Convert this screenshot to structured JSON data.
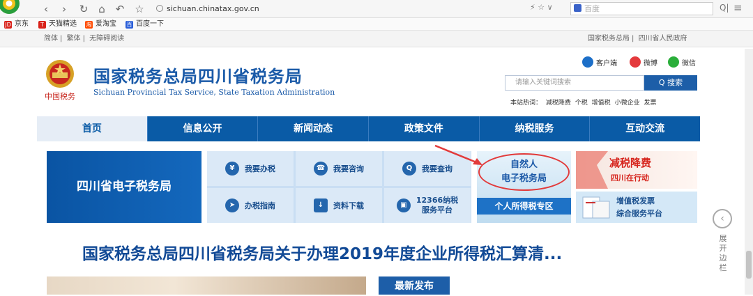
{
  "browser": {
    "url": "sichuan.chinatax.gov.cn",
    "search_placeholder": "百度",
    "right_icons": "⚡ ☆ ∨"
  },
  "bookmarks": [
    {
      "label": "京东",
      "icon_text": "JD",
      "color": "#d9231b"
    },
    {
      "label": "天猫精选",
      "icon_text": "T",
      "color": "#d9231b"
    },
    {
      "label": "爱淘宝",
      "icon_text": "淘",
      "color": "#ff4a00"
    },
    {
      "label": "百度一下",
      "icon_text": "百",
      "color": "#2b5fd9"
    }
  ],
  "util": {
    "left": [
      "简体",
      "繁体",
      "无障碍阅读"
    ],
    "right": [
      "国家税务总局",
      "四川省人民政府"
    ]
  },
  "header": {
    "logo_caption": "中国税务",
    "title": "国家税务总局四川省税务局",
    "subtitle": "Sichuan Provincial Tax Service, State Taxation Administration",
    "social": [
      {
        "label": "客户端",
        "color": "#1d6fc8"
      },
      {
        "label": "微博",
        "color": "#e4393c"
      },
      {
        "label": "微信",
        "color": "#2aae3a"
      }
    ],
    "search_placeholder": "请输入关键词搜索",
    "search_button": "Q 搜索",
    "hot_label": "本站热词：",
    "hot_words": [
      "减税降费",
      "个税",
      "增值税",
      "小微企业",
      "发票"
    ]
  },
  "nav": {
    "items": [
      "首页",
      "信息公开",
      "新闻动态",
      "政策文件",
      "纳税服务",
      "互动交流"
    ]
  },
  "tiles": {
    "etax": "四川省电子税务局",
    "grid": [
      {
        "label": "我要办税",
        "icon": "tax-icon"
      },
      {
        "label": "我要咨询",
        "icon": "headset-icon"
      },
      {
        "label": "我要查询",
        "icon": "query-icon"
      },
      {
        "label": "办税指南",
        "icon": "compass-icon"
      },
      {
        "label": "资料下载",
        "icon": "download-icon"
      },
      {
        "label": "12366纳税服务平台",
        "line1": "12366纳税",
        "line2": "服务平台",
        "icon": "box-icon"
      }
    ],
    "ziranren": {
      "line1": "自然人",
      "line2": "电子税务局",
      "bottom": "个人所得税专区"
    },
    "jianshui": {
      "line1": "减税降费",
      "line2": "四川在行动"
    },
    "zengzhi": {
      "line1": "增值税发票",
      "line2": "综合服务平台"
    }
  },
  "headline": "国家税务总局四川省税务局关于办理2019年度企业所得税汇算清...",
  "side": {
    "label": "展开边栏",
    "chars": [
      "展",
      "开",
      "边",
      "栏"
    ]
  },
  "latest": "最新发布",
  "colors": {
    "brand_blue": "#0a5ba6",
    "accent_red": "#d6241c"
  }
}
